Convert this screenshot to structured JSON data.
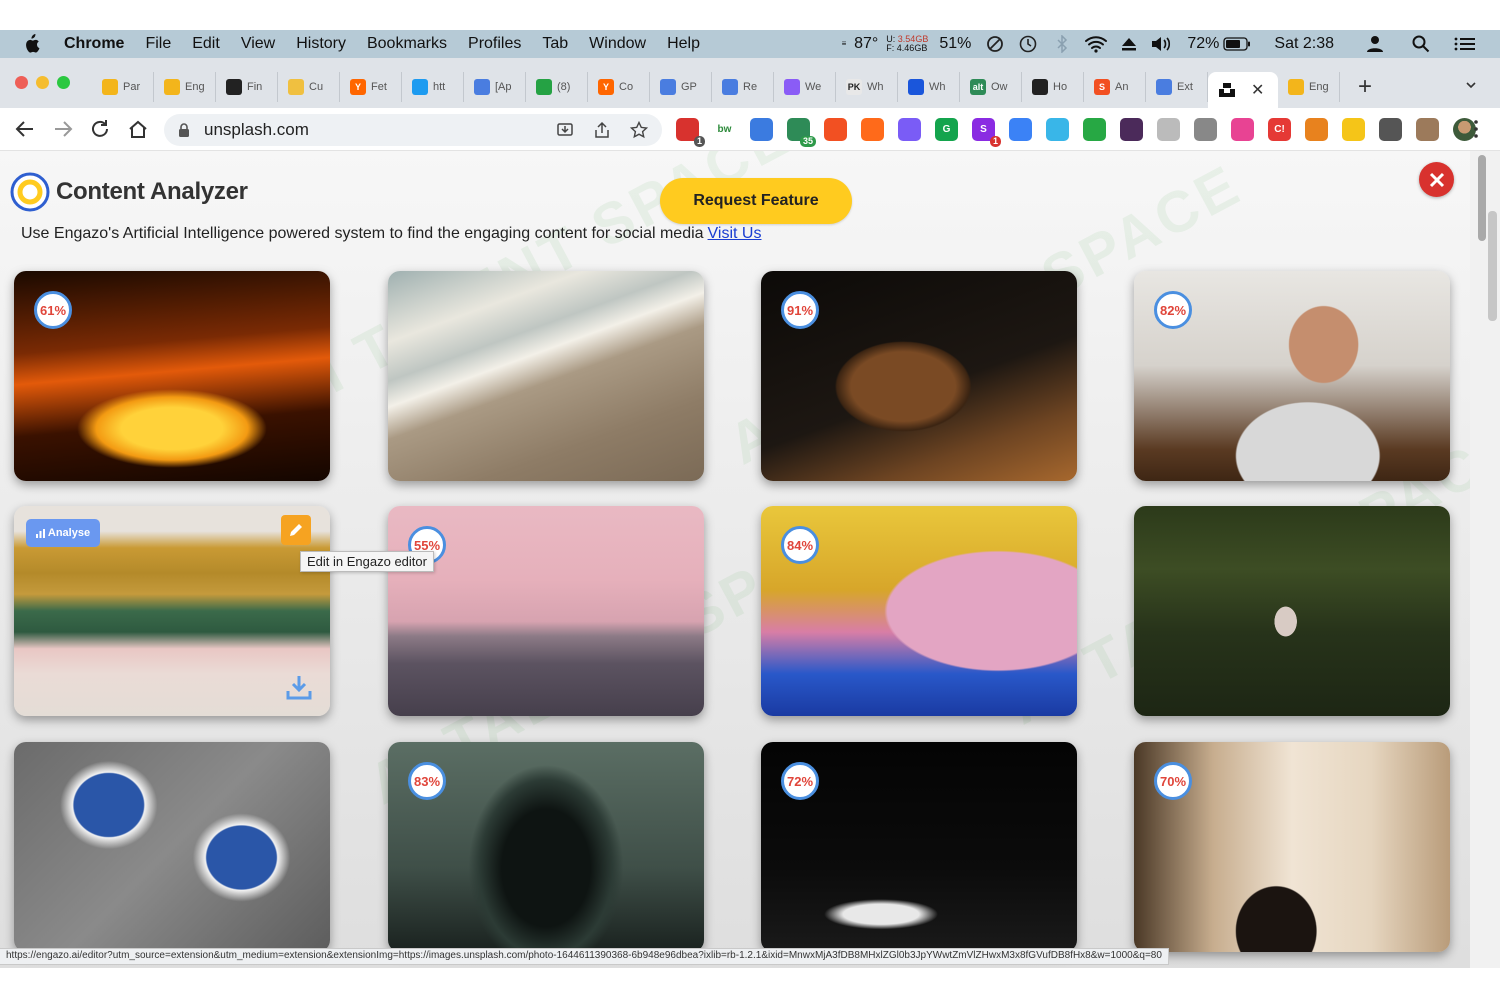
{
  "menubar": {
    "app": "Chrome",
    "items": [
      "File",
      "Edit",
      "View",
      "History",
      "Bookmarks",
      "Profiles",
      "Tab",
      "Window",
      "Help"
    ],
    "temp": "87°",
    "mem_used": "3.54GB",
    "mem_free": "4.46GB",
    "mem_prefix_top": "U:",
    "mem_prefix_bottom": "F:",
    "cpu": "51%",
    "battery": "72%",
    "clock": "Sat 2:38"
  },
  "tabs": [
    {
      "label": "Par",
      "color": "#f3b51b",
      "glyph": ""
    },
    {
      "label": "Eng",
      "color": "#f3b51b",
      "glyph": ""
    },
    {
      "label": "Fin",
      "color": "#222",
      "glyph": ""
    },
    {
      "label": "Cu",
      "color": "#f0c040",
      "glyph": ""
    },
    {
      "label": "Fet",
      "color": "#ff6600",
      "glyph": "Y"
    },
    {
      "label": "htt",
      "color": "#1d9bf0",
      "glyph": ""
    },
    {
      "label": "[Ap",
      "color": "#4a7de0",
      "glyph": ""
    },
    {
      "label": "(8)",
      "color": "#25a244",
      "glyph": ""
    },
    {
      "label": "Co",
      "color": "#ff6600",
      "glyph": "Y"
    },
    {
      "label": "GP",
      "color": "#4a7de0",
      "glyph": ""
    },
    {
      "label": "Re",
      "color": "#4a7de0",
      "glyph": ""
    },
    {
      "label": "We",
      "color": "#8a5cf6",
      "glyph": ""
    },
    {
      "label": "Wh",
      "color": "#e8e8e8",
      "glyph": "PK"
    },
    {
      "label": "Wh",
      "color": "#1a56db",
      "glyph": ""
    },
    {
      "label": "Ow",
      "color": "#2e8b57",
      "glyph": "alt"
    },
    {
      "label": "Ho",
      "color": "#222",
      "glyph": ""
    },
    {
      "label": "An",
      "color": "#f25022",
      "glyph": "S"
    },
    {
      "label": "Ext",
      "color": "#4a7de0",
      "glyph": ""
    }
  ],
  "active_tab": {
    "label": "",
    "color": "#111"
  },
  "after_tab": {
    "label": "Eng",
    "color": "#f3b51b"
  },
  "url": "unsplash.com",
  "extensions": [
    {
      "color": "#d8322e",
      "glyph": "",
      "badge": "1",
      "badge_color": "#555"
    },
    {
      "color": "#fff",
      "glyph": "bw",
      "text_color": "#2c8a3a"
    },
    {
      "color": "#3b7be0",
      "glyph": ""
    },
    {
      "color": "#2e8b57",
      "glyph": "",
      "badge": "35",
      "badge_color": "#2e9a4a"
    },
    {
      "color": "#f25022",
      "glyph": ""
    },
    {
      "color": "#ff6a1a",
      "glyph": ""
    },
    {
      "color": "#7a5cf6",
      "glyph": ""
    },
    {
      "color": "#14a44d",
      "glyph": "G"
    },
    {
      "color": "#8a2be2",
      "glyph": "S",
      "badge": "1",
      "badge_color": "#d8322e"
    },
    {
      "color": "#3b82f6",
      "glyph": ""
    },
    {
      "color": "#39b6e8",
      "glyph": ""
    },
    {
      "color": "#27a844",
      "glyph": ""
    },
    {
      "color": "#4b2a5a",
      "glyph": ""
    },
    {
      "color": "#bbb",
      "glyph": ""
    },
    {
      "color": "#888",
      "glyph": ""
    },
    {
      "color": "#e84393",
      "glyph": ""
    },
    {
      "color": "#e53935",
      "glyph": "C!"
    },
    {
      "color": "#e8821e",
      "glyph": ""
    },
    {
      "color": "#f5c518",
      "glyph": ""
    },
    {
      "color": "#555",
      "glyph": ""
    },
    {
      "color": "#9c7a5b",
      "glyph": ""
    }
  ],
  "analyzer": {
    "title": "Content Analyzer",
    "request_button": "Request Feature",
    "tagline": "Use Engazo's Artificial Intelligence powered system to find the engaging content for social media",
    "link": "Visit Us",
    "analyse_label": "Analyse",
    "tooltip": "Edit in Engazo editor",
    "watermark": "AI TALENT SPACE"
  },
  "cards": [
    {
      "score": "61%",
      "desc": "taxi-motion"
    },
    {
      "score": "",
      "desc": "beach-wave"
    },
    {
      "score": "91%",
      "desc": "coffee-bowl"
    },
    {
      "score": "82%",
      "desc": "family-laptop"
    },
    {
      "score": "",
      "desc": "knit-hats",
      "hovered": true
    },
    {
      "score": "55%",
      "desc": "pink-sea"
    },
    {
      "score": "84%",
      "desc": "coins-stairs"
    },
    {
      "score": "",
      "desc": "forest-girl"
    },
    {
      "score": "",
      "desc": "sneakers"
    },
    {
      "score": "83%",
      "desc": "escalator"
    },
    {
      "score": "72%",
      "desc": "dark-cave"
    },
    {
      "score": "70%",
      "desc": "window-woman"
    }
  ],
  "status_url": "https://engazo.ai/editor?utm_source=extension&utm_medium=extension&extensionImg=https://images.unsplash.com/photo-1644611390368-6b948e96dbea?ixlib=rb-1.2.1&ixid=MnwxMjA3fDB8MHxlZGl0b3JpYWwtZmVlZHwxM3x8fGVufDB8fHx8&w=1000&q=80",
  "colors": {
    "accent": "#ffcb1f",
    "close": "#d8322e",
    "score_ring": "#4a8fe0",
    "score_text": "#e0453a",
    "analyse": "#6a98f0",
    "edit": "#f6a321"
  }
}
